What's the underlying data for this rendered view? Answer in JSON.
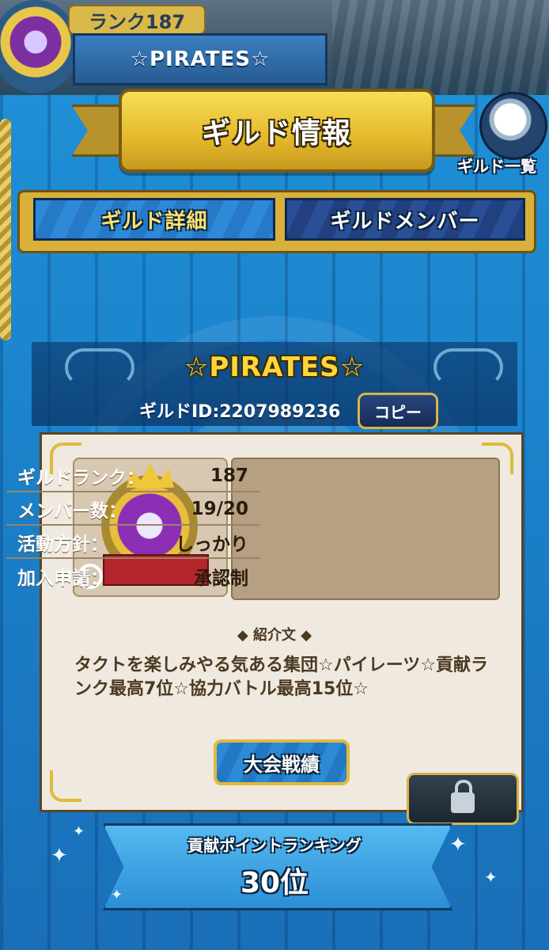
{
  "header": {
    "rank_label": "ランク187",
    "guild_name": "☆PIRATES☆"
  },
  "banner": {
    "title": "ギルド情報"
  },
  "search": {
    "label": "ギルド一覧"
  },
  "tabs": [
    {
      "label": "ギルド詳細",
      "active": true
    },
    {
      "label": "ギルドメンバー",
      "active": false
    }
  ],
  "guild": {
    "title": "☆PIRATES☆",
    "id_text": "ギルドID:2207989236",
    "copy_label": "コピー"
  },
  "info": [
    {
      "label": "ギルドランク：",
      "value": "187"
    },
    {
      "label": "メンバー数：",
      "value": "19/20"
    },
    {
      "label": "活動方針：",
      "value": "しっかり"
    },
    {
      "label": "加入申請：",
      "value": "承認制"
    }
  ],
  "intro": {
    "heading": "紹介文",
    "text": "タクトを楽しみやる気ある集団☆パイレーツ☆貢献ランク最高7位☆協力バトル最高15位☆"
  },
  "buttons": {
    "tournament": "大会戦績"
  },
  "ranking": {
    "label": "貢献ポイントランキング",
    "value": "30位"
  },
  "colors": {
    "accent_gold": "#e4b92c",
    "tab_active": "#2e8ad8",
    "tab_inactive": "#2b4f96",
    "parchment": "#efe9df",
    "background_blue": "#1a7fc8"
  }
}
